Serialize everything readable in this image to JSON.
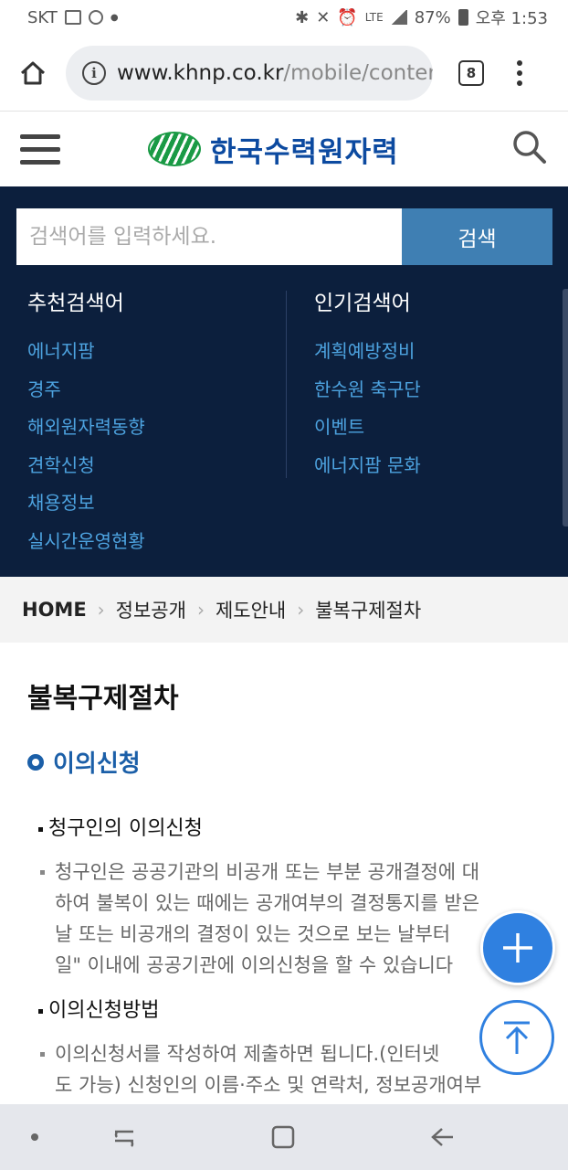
{
  "status_bar": {
    "carrier": "SKT",
    "battery": "87%",
    "time": "오후 1:53",
    "network": "LTE"
  },
  "browser": {
    "url_domain": "www.khnp.co.kr",
    "url_path": "/mobile/conter",
    "tab_count": "8"
  },
  "site": {
    "logo_text": "한국수력원자력"
  },
  "search": {
    "placeholder": "검색어를 입력하세요.",
    "button": "검색",
    "recommended_title": "추천검색어",
    "recommended": [
      "에너지팜",
      "경주",
      "해외원자력동향",
      "견학신청",
      "채용정보",
      "실시간운영현황"
    ],
    "popular_title": "인기검색어",
    "popular": [
      "계획예방정비",
      "한수원 축구단",
      "이벤트",
      "에너지팜 문화"
    ]
  },
  "breadcrumb": {
    "home": "HOME",
    "items": [
      "정보공개",
      "제도안내",
      "불복구제절차"
    ]
  },
  "content": {
    "page_title": "불복구제절차",
    "section_title": "이의신청",
    "sub1": "청구인의 이의신청",
    "para1_lines": [
      "청구인은 공공기관의 비공개 또는 부분 공개결정에 대",
      "하여 불복이 있는 때에는 공개여부의 결정통지를 받은",
      "날 또는 비공개의 결정이 있는 것으로 보는 날부터",
      "일\" 이내에 공공기관에 이의신청을 할 수 있습니다"
    ],
    "sub2": "이의신청방법",
    "para2_lines": [
      "이의신청서를 작성하여 제출하면 됩니다.(인터넷",
      "도 가능) 신청인의 이름·주소 및 연락처, 정보공개여부"
    ]
  },
  "colors": {
    "panel_bg": "#0c1f3d",
    "link": "#4da3e0",
    "accent": "#1b5fa8",
    "search_button": "#3f7fb3",
    "fab": "#2f80e0"
  }
}
